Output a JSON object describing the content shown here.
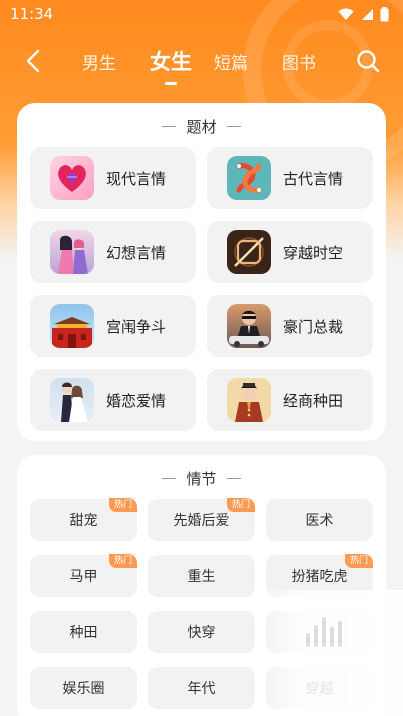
{
  "status_bar": {
    "time": "11:34"
  },
  "nav": {
    "tabs": [
      {
        "label": "男生",
        "active": false
      },
      {
        "label": "女生",
        "active": true
      },
      {
        "label": "短篇",
        "active": false
      },
      {
        "label": "图书",
        "active": false
      }
    ]
  },
  "topic_section": {
    "title": "题材",
    "items": [
      {
        "label": "现代言情",
        "icon": "diamond-heart-icon"
      },
      {
        "label": "古代言情",
        "icon": "koi-fish-icon"
      },
      {
        "label": "幻想言情",
        "icon": "couple-illustration-icon"
      },
      {
        "label": "穿越时空",
        "icon": "time-portal-icon"
      },
      {
        "label": "宫闱争斗",
        "icon": "palace-icon"
      },
      {
        "label": "豪门总裁",
        "icon": "ceo-car-icon"
      },
      {
        "label": "婚恋爱情",
        "icon": "wedding-couple-icon"
      },
      {
        "label": "经商种田",
        "icon": "merchant-icon"
      }
    ]
  },
  "plot_section": {
    "title": "情节",
    "hot_badge": "热门",
    "items": [
      {
        "label": "甜宠",
        "hot": true
      },
      {
        "label": "先婚后爱",
        "hot": true
      },
      {
        "label": "医术",
        "hot": false
      },
      {
        "label": "马甲",
        "hot": true
      },
      {
        "label": "重生",
        "hot": false
      },
      {
        "label": "扮猪吃虎",
        "hot": true
      },
      {
        "label": "种田",
        "hot": false
      },
      {
        "label": "快穿",
        "hot": false
      },
      {
        "label": "",
        "hot": false
      },
      {
        "label": "娱乐圈",
        "hot": false
      },
      {
        "label": "年代",
        "hot": false
      },
      {
        "label": "穿越",
        "hot": false
      }
    ]
  },
  "colors": {
    "accent": "#ff8a1f",
    "badge": "#ff9a54"
  }
}
